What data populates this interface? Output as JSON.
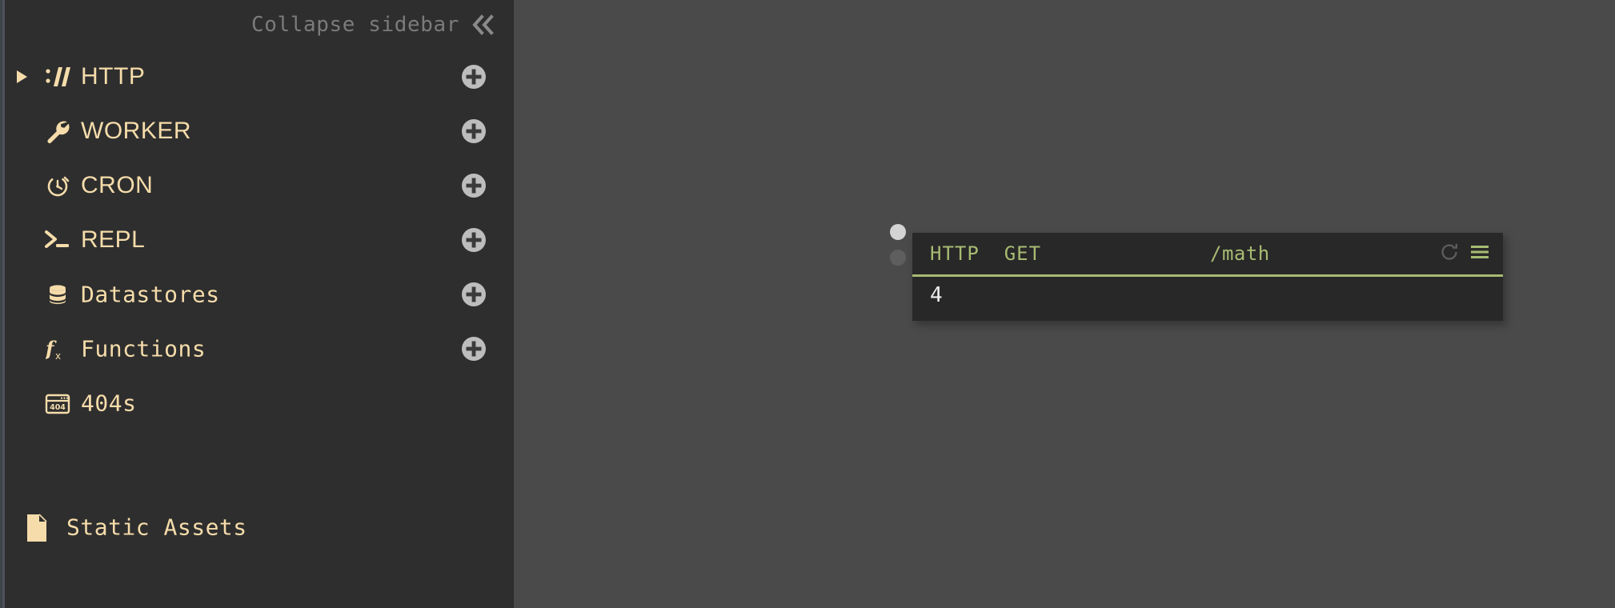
{
  "sidebar": {
    "collapse": {
      "label": "Collapse sidebar",
      "icon": "chevron-double-left-icon"
    },
    "items": [
      {
        "label": "HTTP",
        "icon": "protocol-slashes-icon",
        "style": "caps",
        "expandable": true,
        "add": true
      },
      {
        "label": "WORKER",
        "icon": "wrench-icon",
        "style": "caps",
        "expandable": false,
        "add": true
      },
      {
        "label": "CRON",
        "icon": "stopwatch-icon",
        "style": "caps",
        "expandable": false,
        "add": true
      },
      {
        "label": "REPL",
        "icon": "terminal-prompt-icon",
        "style": "caps",
        "expandable": false,
        "add": true
      },
      {
        "label": "Datastores",
        "icon": "database-icon",
        "style": "mono",
        "expandable": false,
        "add": true
      },
      {
        "label": "Functions",
        "icon": "fx-icon",
        "style": "mono",
        "expandable": false,
        "add": true
      },
      {
        "label": "404s",
        "icon": "browser-404-icon",
        "style": "mono",
        "expandable": false,
        "add": false
      }
    ],
    "static_assets": {
      "label": "Static Assets",
      "icon": "document-icon"
    },
    "add_button_icon": "plus-circle-icon"
  },
  "canvas": {
    "ports": [
      {
        "name": "output-port-top",
        "state": "active"
      },
      {
        "name": "output-port-bottom",
        "state": "inactive"
      }
    ],
    "request_card": {
      "method": "HTTP  GET",
      "path": "/math",
      "response": "4",
      "actions": [
        {
          "name": "refresh-icon",
          "label": "refresh"
        },
        {
          "name": "menu-icon",
          "label": "menu"
        }
      ]
    }
  },
  "colors": {
    "sidebar_bg": "#2e2e2e",
    "canvas_bg": "#4a4a4a",
    "accent_tan": "#f5dcaa",
    "accent_green": "#a8bb72",
    "card_bg": "#282828",
    "muted_gray": "#7b7b7b"
  }
}
